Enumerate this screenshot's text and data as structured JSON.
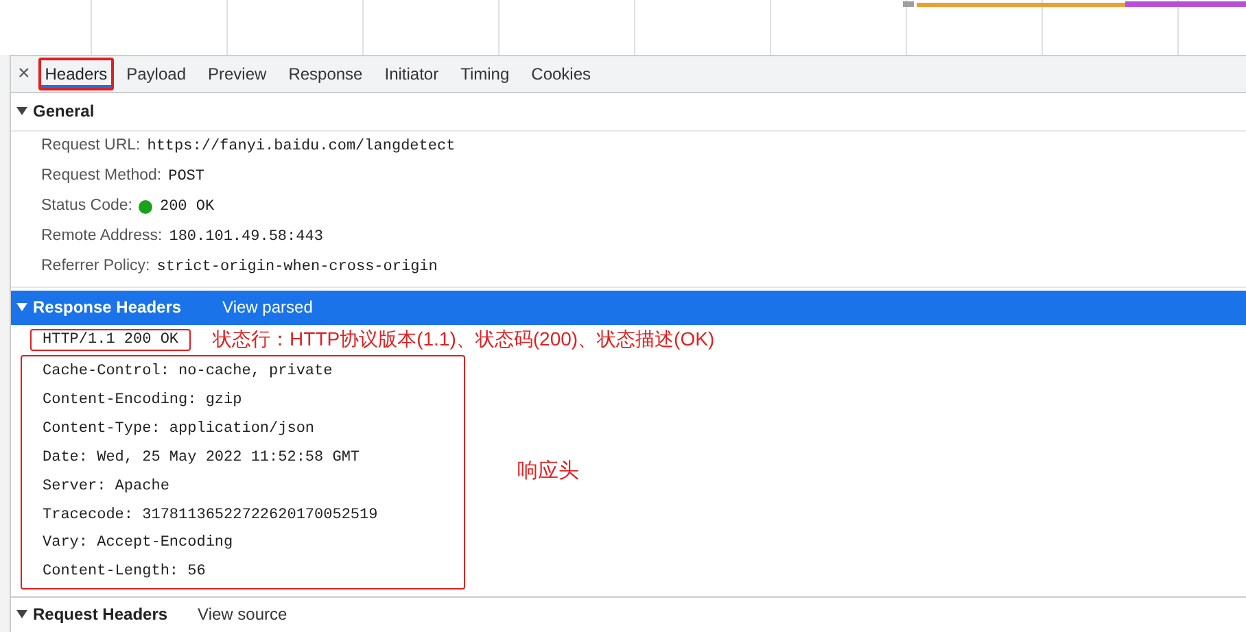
{
  "tabs": [
    {
      "label": "Headers",
      "selected": true
    },
    {
      "label": "Payload",
      "selected": false
    },
    {
      "label": "Preview",
      "selected": false
    },
    {
      "label": "Response",
      "selected": false
    },
    {
      "label": "Initiator",
      "selected": false
    },
    {
      "label": "Timing",
      "selected": false
    },
    {
      "label": "Cookies",
      "selected": false
    }
  ],
  "close_label": "×",
  "general": {
    "title": "General",
    "expanded": true,
    "rows": [
      {
        "name": "Request URL:",
        "value": "https://fanyi.baidu.com/langdetect"
      },
      {
        "name": "Request Method:",
        "value": "POST"
      },
      {
        "name": "Status Code:",
        "value": "200 OK",
        "color": "#1aa31a"
      },
      {
        "name": "Remote Address:",
        "value": "180.101.49.58:443"
      },
      {
        "name": "Referrer Policy:",
        "value": "strict-origin-when-cross-origin"
      }
    ]
  },
  "response_headers": {
    "title": "Response Headers",
    "expanded": true,
    "selected": true,
    "link": "View parsed",
    "status_line": "HTTP/1.1 200 OK",
    "status_note": "状态行：HTTP协议版本(1.1)、状态码(200)、状态描述(OK)",
    "headers_note": "响应头",
    "rows": [
      {
        "name": "Cache-Control:",
        "value": "no-cache, private"
      },
      {
        "name": "Content-Encoding:",
        "value": "gzip"
      },
      {
        "name": "Content-Type:",
        "value": "application/json"
      },
      {
        "name": "Date:",
        "value": "Wed, 25 May 2022 11:52:58 GMT"
      },
      {
        "name": "Server:",
        "value": "Apache"
      },
      {
        "name": "Tracecode:",
        "value": "31781136522722620170052519"
      },
      {
        "name": "Vary:",
        "value": "Accept-Encoding"
      },
      {
        "name": "Content-Length:",
        "value": "56"
      }
    ]
  },
  "request_headers": {
    "title": "Request Headers",
    "expanded": true,
    "link": "View source"
  }
}
